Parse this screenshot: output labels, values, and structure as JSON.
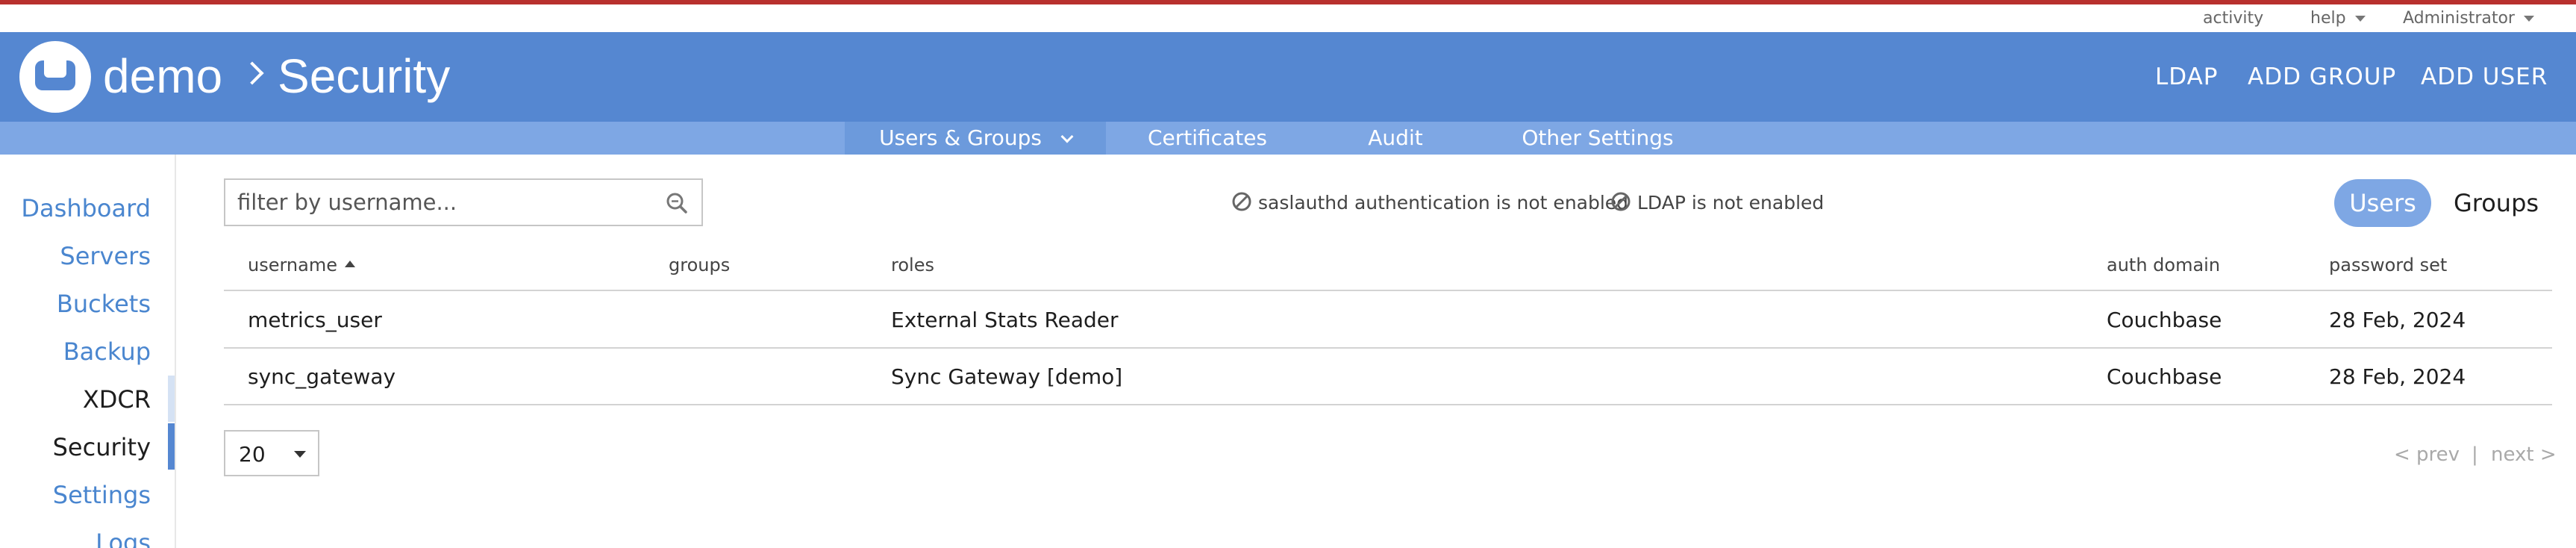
{
  "top_bar": {
    "activity": "activity",
    "help": "help",
    "user": "Administrator"
  },
  "header": {
    "cluster": "demo",
    "section": "Security",
    "actions": [
      "LDAP",
      "ADD GROUP",
      "ADD USER"
    ]
  },
  "subnav": {
    "items": [
      "Users & Groups",
      "Certificates",
      "Audit",
      "Other Settings"
    ],
    "active": "Users & Groups"
  },
  "sidebar": {
    "items": [
      "Dashboard",
      "Servers",
      "Buckets",
      "Backup",
      "XDCR",
      "Security",
      "Settings",
      "Logs"
    ],
    "active": "Security"
  },
  "search": {
    "placeholder": "filter by username..."
  },
  "notices": [
    "saslauthd authentication is not enabled",
    "LDAP is not enabled"
  ],
  "view_toggle": {
    "users": "Users",
    "groups": "Groups",
    "active": "Users"
  },
  "table": {
    "columns": [
      "username",
      "groups",
      "roles",
      "auth domain",
      "password set"
    ],
    "sort_column": "username",
    "sort_direction": "ascending",
    "rows": [
      [
        "metrics_user",
        "",
        "External Stats Reader",
        "Couchbase",
        "28 Feb, 2024"
      ],
      [
        "sync_gateway",
        "",
        "Sync Gateway [demo]",
        "Couchbase",
        "28 Feb, 2024"
      ]
    ]
  },
  "pagination": {
    "page_size": "20",
    "prev": "< prev",
    "separator": "|",
    "next": "next >"
  },
  "colors": {
    "accent_red": "#b8302e",
    "header_blue": "#5587d1",
    "subnav_blue": "#7ea7e4",
    "link_blue": "#4a86cf"
  }
}
